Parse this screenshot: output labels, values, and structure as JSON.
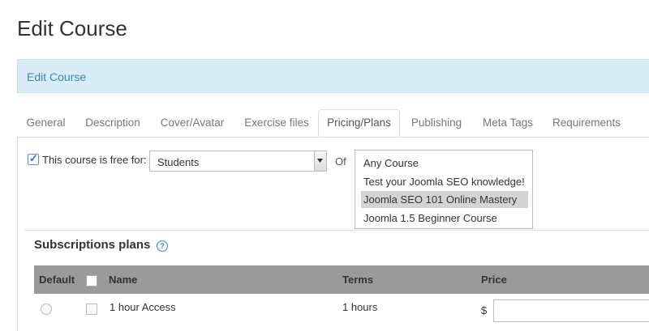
{
  "page": {
    "title": "Edit Course"
  },
  "info_bar": {
    "text": "Edit Course"
  },
  "tabs": [
    {
      "label": "General"
    },
    {
      "label": "Description"
    },
    {
      "label": "Cover/Avatar"
    },
    {
      "label": "Exercise files"
    },
    {
      "label": "Pricing/Plans",
      "active": true
    },
    {
      "label": "Publishing"
    },
    {
      "label": "Meta Tags"
    },
    {
      "label": "Requirements"
    }
  ],
  "free": {
    "checked": true,
    "label": "This course is free for:",
    "select_value": "Students",
    "of_label": "Of"
  },
  "course_list": [
    {
      "label": "Any Course"
    },
    {
      "label": "Test your Joomla SEO knowledge!"
    },
    {
      "label": "Joomla SEO 101 Online Mastery",
      "selected": true
    },
    {
      "label": "Joomla 1.5 Beginner Course"
    }
  ],
  "subscriptions": {
    "title": "Subscriptions plans",
    "help_icon": "?",
    "columns": {
      "default": "Default",
      "name": "Name",
      "terms": "Terms",
      "price": "Price"
    },
    "rows": [
      {
        "name": "1 hour Access",
        "terms": "1 hours",
        "currency": "$",
        "price": ""
      }
    ]
  }
}
